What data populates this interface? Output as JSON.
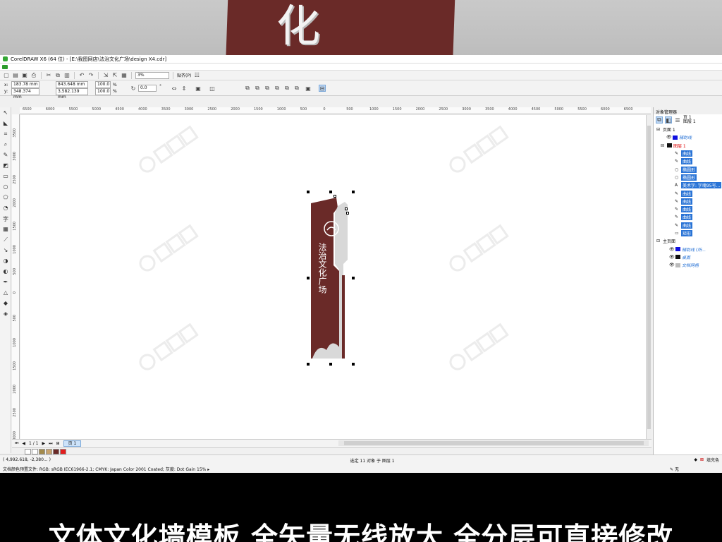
{
  "app": {
    "title": "CorelDRAW X6 (64 位) - [E:\\我图网店\\法治文化广场\\design X4.cdr]",
    "brand_color": "#35a735"
  },
  "toolbar": {
    "zoom": "3%",
    "snap_label": "贴齐(P)"
  },
  "propbar": {
    "x_label": "x:",
    "x": "183.78 mm",
    "y_label": "y:",
    "y": "348.374 mm",
    "w": "843.648 mm",
    "h": "3,582.139 mm",
    "scale_w": "100.0",
    "scale_h": "100.0",
    "percent": "%",
    "angle": "0.0",
    "angle_unit": "°"
  },
  "rulers": {
    "h_ticks": [
      "6500",
      "6000",
      "5500",
      "5000",
      "4500",
      "4000",
      "3500",
      "3000",
      "2500",
      "2000",
      "1500",
      "1000",
      "500",
      "0",
      "500",
      "1000",
      "1500",
      "2000",
      "2500",
      "3000",
      "3500",
      "4000",
      "4500",
      "5000",
      "5500",
      "6000",
      "6500"
    ],
    "v_ticks": [
      "3500",
      "3000",
      "2500",
      "2000",
      "1500",
      "1000",
      "500",
      "0",
      "500",
      "1000",
      "1500",
      "2000",
      "2500",
      "3000"
    ]
  },
  "design": {
    "sign_text": "法治文化广场",
    "sign_color": "#6a2a28"
  },
  "pagebar": {
    "counter": "1 / 1",
    "page_tab": "页 1"
  },
  "palette": [
    "#ffffff",
    "#ffffff",
    "#a28a4c",
    "#c8a36d",
    "#6a2a28",
    "#e21d1d"
  ],
  "status": {
    "coords": "( 4,992.618, -2,380... )",
    "selection": "选定 11 对象 于 图层 1",
    "doc_profile": "文档颜色预置文件: RGB: sRGB IEC61966-2.1; CMYK: Japan Color 2001 Coated; 灰度: Dot Gain 15% ▸",
    "fill_label": "填充色",
    "outline_label": "无"
  },
  "docker": {
    "title": "对象管理器",
    "top_label": "页 1",
    "top_sub": "图层 1",
    "page1": "页面 1",
    "guides": "辅助线",
    "layer1": "图层 1",
    "items": [
      "曲线",
      "曲线",
      "椭圆形",
      "椭圆形",
      "美术字: 字魂95号...",
      "曲线",
      "曲线",
      "曲线",
      "曲线",
      "曲线",
      "矩形"
    ],
    "master": "主页面",
    "master_items": [
      "辅助线 (所...",
      "桌面",
      "文档网格"
    ]
  },
  "banner": {
    "text": "文体文化墙模板  全矢量无线放大 全分层可直接修改"
  }
}
